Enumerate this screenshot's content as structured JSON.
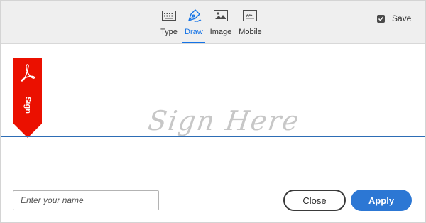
{
  "toolbar": {
    "tabs": [
      {
        "label": "Type",
        "icon": "keyboard-icon",
        "active": false
      },
      {
        "label": "Draw",
        "icon": "pen-icon",
        "active": true
      },
      {
        "label": "Image",
        "icon": "image-icon",
        "active": false
      },
      {
        "label": "Mobile",
        "icon": "mobile-icon",
        "active": false
      }
    ],
    "save_label": "Save",
    "save_checked": true
  },
  "sign_area": {
    "flag_label": "Sign",
    "flag_icon": "acrobat-logo-icon",
    "placeholder": "Sign Here"
  },
  "footer": {
    "name_placeholder": "Enter your name",
    "name_value": "",
    "close_label": "Close",
    "apply_label": "Apply"
  },
  "colors": {
    "accent": "#1473e6",
    "apply_button": "#2c77d4",
    "flag_red": "#eb1000",
    "signature_line": "#2d6db5",
    "toolbar_bg": "#efefef"
  }
}
